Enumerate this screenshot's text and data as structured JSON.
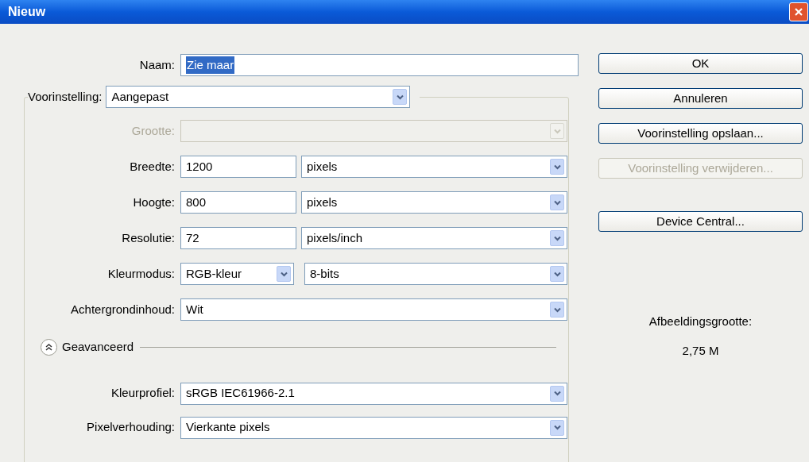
{
  "window": {
    "title": "Nieuw"
  },
  "name_field": {
    "label": "Naam:",
    "value": "Zie maar",
    "selected": true
  },
  "preset": {
    "label": "Voorinstelling:",
    "value": "Aangepast"
  },
  "size": {
    "label": "Grootte:",
    "disabled": true
  },
  "fields": [
    {
      "kind": "number_unit",
      "label": "Breedte:",
      "value": "1200",
      "unit": "pixels"
    },
    {
      "kind": "number_unit",
      "label": "Hoogte:",
      "value": "800",
      "unit": "pixels"
    },
    {
      "kind": "number_unit",
      "label": "Resolutie:",
      "value": "72",
      "unit": "pixels/inch"
    },
    {
      "kind": "double_select",
      "label": "Kleurmodus:",
      "value": "RGB-kleur",
      "unit": "8-bits"
    },
    {
      "kind": "select",
      "label": "Achtergrondinhoud:",
      "value": "Wit"
    }
  ],
  "advanced": {
    "label": "Geavanceerd",
    "expanded": true
  },
  "advanced_fields": [
    {
      "label": "Kleurprofiel:",
      "value": "sRGB IEC61966-2.1"
    },
    {
      "label": "Pixelverhouding:",
      "value": "Vierkante pixels"
    }
  ],
  "buttons": [
    {
      "label": "OK",
      "disabled": false
    },
    {
      "label": "Annuleren",
      "disabled": false
    },
    {
      "label": "Voorinstelling opslaan...",
      "disabled": false
    },
    {
      "label": "Voorinstelling verwijderen...",
      "disabled": true
    },
    {
      "label": "Device Central...",
      "disabled": false
    }
  ],
  "image_size": {
    "label": "Afbeeldingsgrootte:",
    "value": "2,75 M"
  }
}
